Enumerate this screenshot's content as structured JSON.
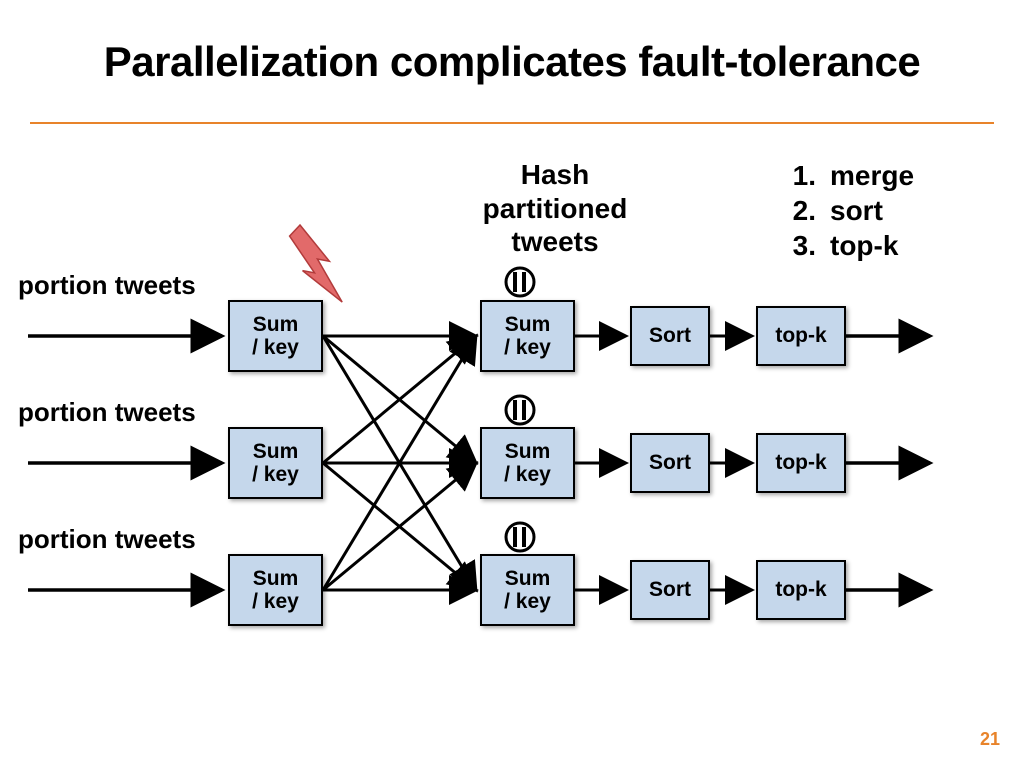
{
  "title": "Parallelization complicates fault-tolerance",
  "page_number": "21",
  "labels": {
    "hash_partitioned_line1": "Hash",
    "hash_partitioned_line2": "partitioned",
    "hash_partitioned_line3": "tweets",
    "portion": "portion tweets"
  },
  "steps": [
    {
      "n": "1.",
      "t": "merge"
    },
    {
      "n": "2.",
      "t": "sort"
    },
    {
      "n": "3.",
      "t": "top-k"
    }
  ],
  "box": {
    "sumkey_l1": "Sum",
    "sumkey_l2": "/ key",
    "sort": "Sort",
    "topk": "top-k"
  },
  "colors": {
    "accent": "#e8832a",
    "box": "#c5d7eb",
    "bolt": "#e26a6a"
  },
  "rows_y": [
    300,
    427,
    554
  ],
  "col_x": {
    "sumA": 228,
    "sumB": 480,
    "sort": 630,
    "topk": 756
  },
  "sizes": {
    "sumW": 95,
    "sumH": 72,
    "sortW": 80,
    "sortH": 60,
    "topkW": 90,
    "topkH": 60
  }
}
